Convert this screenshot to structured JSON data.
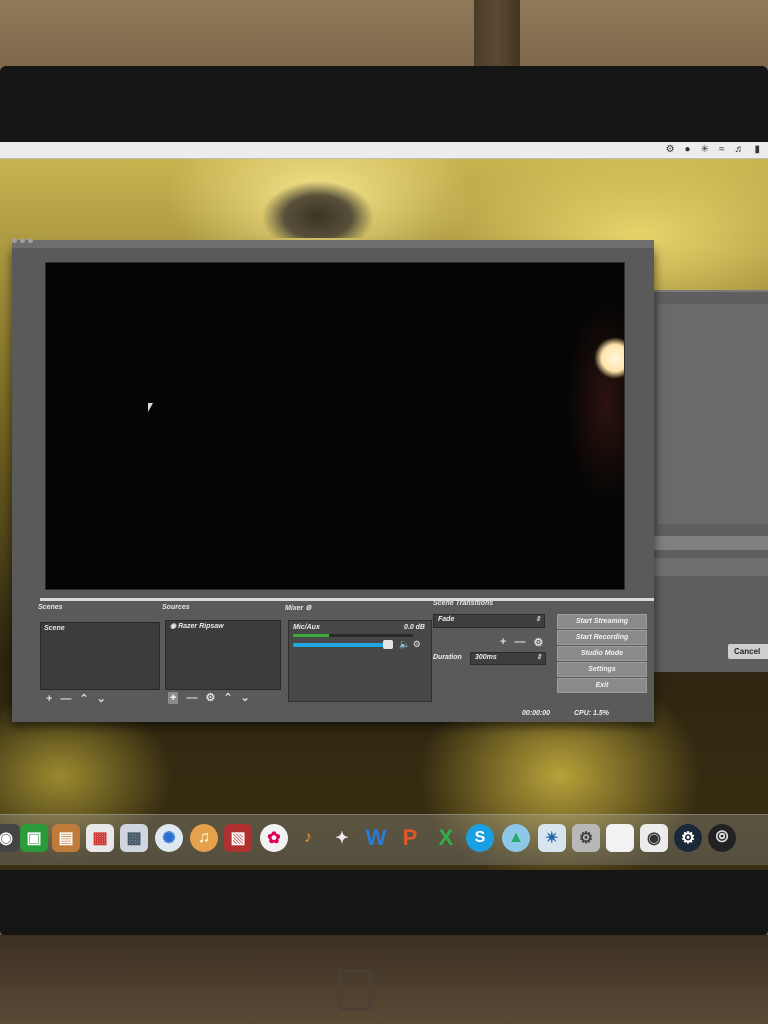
{
  "obs": {
    "sections": {
      "scenes": "Scenes",
      "sources": "Sources",
      "mixer": "Mixer",
      "scene_transitions": "Scene Transitions"
    },
    "scenes_list": [
      "Scene"
    ],
    "sources_list": [
      "Razer Ripsaw"
    ],
    "mixer": {
      "channel_name": "Mic/Aux",
      "level": "0.0 dB",
      "meter_fraction": 0.3,
      "volume_fraction": 0.85
    },
    "transitions": {
      "selected": "Fade",
      "duration_label": "Duration",
      "duration_value": "300ms"
    },
    "controls": {
      "start_streaming": "Start Streaming",
      "start_recording": "Start Recording",
      "studio_mode": "Studio Mode",
      "settings": "Settings",
      "exit": "Exit"
    },
    "status": {
      "time": "00:00:00",
      "cpu": "CPU: 1.5%"
    }
  },
  "background_window": {
    "cancel_label": "Cancel"
  },
  "dock": {
    "icons": [
      "finder-icon",
      "facetime-icon",
      "contacts-icon",
      "calendar-icon",
      "preview-icon",
      "safari-icon",
      "itunes-icon",
      "photo-booth-icon",
      "photos-icon",
      "garageband-icon",
      "inkscape-icon",
      "word-icon",
      "powerpoint-icon",
      "excel-icon",
      "skype-icon",
      "app-store-icon",
      "system-preferences-icon",
      "disk-icon",
      "folder-icon",
      "controller-icon",
      "steam-icon",
      "obs-icon"
    ]
  },
  "colors": {
    "accent_blue": "#1ea7e1",
    "meter_green": "#3caa3c",
    "window_bg": "#5a5a5a"
  }
}
